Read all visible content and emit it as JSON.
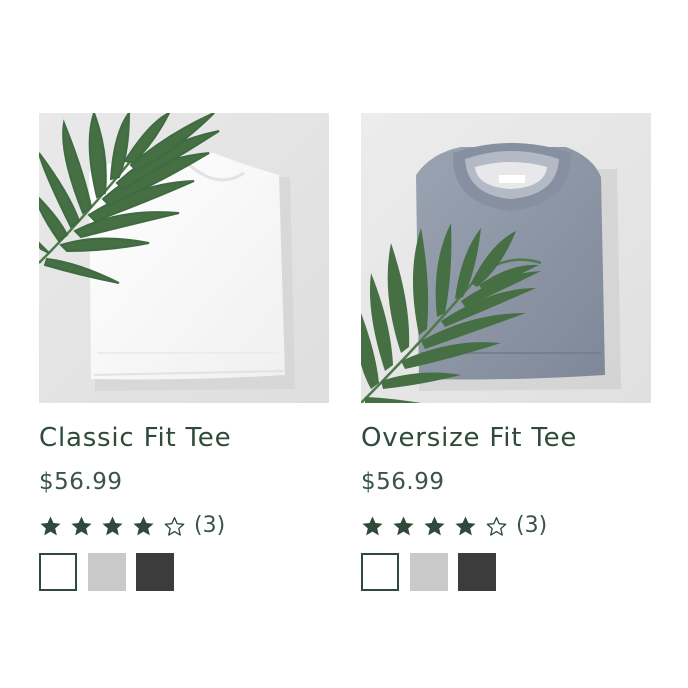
{
  "products": [
    {
      "title": "Classic Fit Tee",
      "price": "$56.99",
      "rating": 4,
      "max_rating": 5,
      "rating_count": "(3)",
      "image_icon": "white-tshirt-with-palm-leaf",
      "swatches": [
        {
          "name": "white",
          "color": "#ffffff",
          "selected": true
        },
        {
          "name": "gray",
          "color": "#c9c9c9",
          "selected": false
        },
        {
          "name": "black",
          "color": "#3c3c3c",
          "selected": false
        }
      ]
    },
    {
      "title": "Oversize Fit Tee",
      "price": "$56.99",
      "rating": 4,
      "max_rating": 5,
      "rating_count": "(3)",
      "image_icon": "gray-tshirt-with-palm-leaf",
      "swatches": [
        {
          "name": "white",
          "color": "#ffffff",
          "selected": true
        },
        {
          "name": "gray",
          "color": "#c9c9c9",
          "selected": false
        },
        {
          "name": "black",
          "color": "#3c3c3c",
          "selected": false
        }
      ]
    }
  ],
  "colors": {
    "accent": "#2f4a3a",
    "star": "#2f4a3a"
  }
}
